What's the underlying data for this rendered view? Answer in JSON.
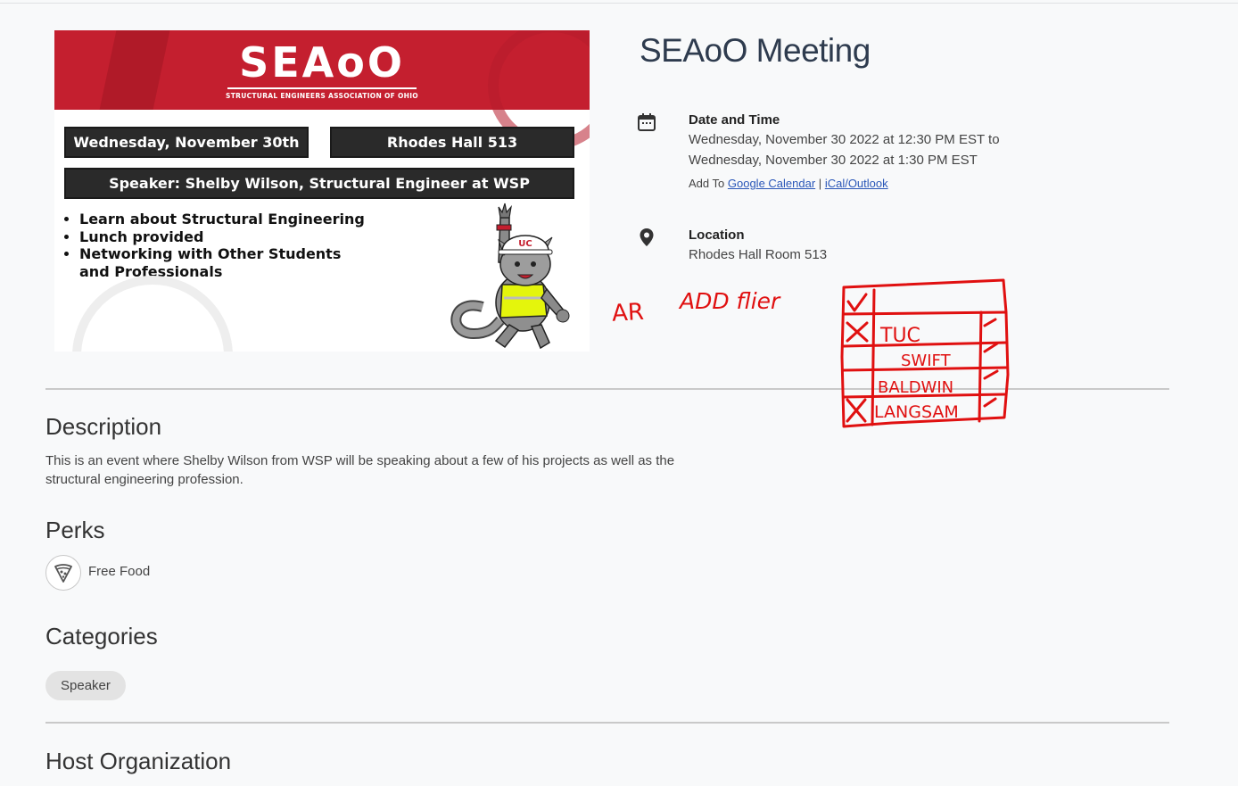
{
  "event": {
    "title": "SEAoO Meeting",
    "date_label": "Date and Time",
    "date_line1": "Wednesday, November 30 2022 at 12:30 PM EST to",
    "date_line2": "Wednesday, November 30 2022 at 1:30 PM EST",
    "add_to_prefix": "Add To",
    "google_calendar": "Google Calendar",
    "separator": "|",
    "ical": "iCal/Outlook",
    "location_label": "Location",
    "location": "Rhodes Hall Room 513"
  },
  "flyer": {
    "logo": "SEAoO",
    "logo_sub": "STRUCTURAL ENGINEERS ASSOCIATION OF OHIO",
    "date_bar": "Wednesday, November 30th",
    "room_bar": "Rhodes Hall 513",
    "speaker_bar": "Speaker: Shelby Wilson, Structural Engineer at WSP",
    "bullets": [
      "Learn about Structural Engineering",
      "Lunch provided",
      "Networking with Other Students and Professionals"
    ],
    "hat_badge": "UC"
  },
  "description": {
    "heading": "Description",
    "text": "This is an event where Shelby Wilson from WSP will be speaking about a few of his projects as well as the structural engineering profession."
  },
  "perks": {
    "heading": "Perks",
    "items": [
      {
        "icon": "pizza-icon",
        "label": "Free Food"
      }
    ]
  },
  "categories": {
    "heading": "Categories",
    "items": [
      "Speaker"
    ]
  },
  "host": {
    "heading": "Host Organization"
  },
  "annotations": {
    "note1": "AR",
    "note2": "ADD flier",
    "table_rows": [
      "TUC",
      "SWIFT",
      "BALDWIN",
      "LANGSAM"
    ],
    "header_mark": "✓",
    "color": "#e01010"
  },
  "colors": {
    "accent_red": "#c41f2f",
    "link": "#2a57b8",
    "title": "#2e3b4e"
  }
}
